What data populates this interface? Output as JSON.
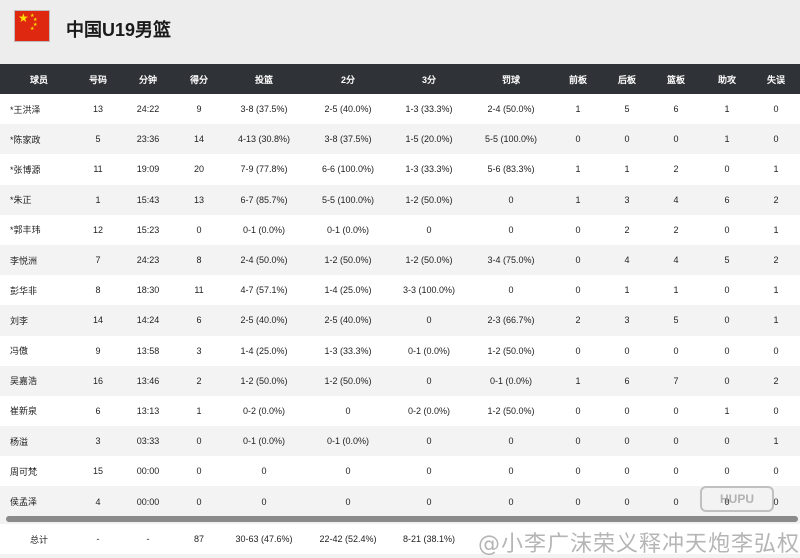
{
  "team": {
    "name": "中国U19男篮",
    "flag_icon": "china-flag-icon"
  },
  "columns": [
    "球员",
    "号码",
    "分钟",
    "得分",
    "投篮",
    "2分",
    "3分",
    "罚球",
    "前板",
    "后板",
    "篮板",
    "助攻",
    "失误"
  ],
  "rows": [
    [
      "*王洪泽",
      "13",
      "24:22",
      "9",
      "3-8 (37.5%)",
      "2-5 (40.0%)",
      "1-3 (33.3%)",
      "2-4 (50.0%)",
      "1",
      "5",
      "6",
      "1",
      "0"
    ],
    [
      "*陈家政",
      "5",
      "23:36",
      "14",
      "4-13 (30.8%)",
      "3-8 (37.5%)",
      "1-5 (20.0%)",
      "5-5 (100.0%)",
      "0",
      "0",
      "0",
      "1",
      "0"
    ],
    [
      "*张博源",
      "11",
      "19:09",
      "20",
      "7-9 (77.8%)",
      "6-6 (100.0%)",
      "1-3 (33.3%)",
      "5-6 (83.3%)",
      "1",
      "1",
      "2",
      "0",
      "1"
    ],
    [
      "*朱正",
      "1",
      "15:43",
      "13",
      "6-7 (85.7%)",
      "5-5 (100.0%)",
      "1-2 (50.0%)",
      "0",
      "1",
      "3",
      "4",
      "6",
      "2"
    ],
    [
      "*郭丰玮",
      "12",
      "15:23",
      "0",
      "0-1 (0.0%)",
      "0-1 (0.0%)",
      "0",
      "0",
      "0",
      "2",
      "2",
      "0",
      "1"
    ],
    [
      "李悦洲",
      "7",
      "24:23",
      "8",
      "2-4 (50.0%)",
      "1-2 (50.0%)",
      "1-2 (50.0%)",
      "3-4 (75.0%)",
      "0",
      "4",
      "4",
      "5",
      "2"
    ],
    [
      "彭华非",
      "8",
      "18:30",
      "11",
      "4-7 (57.1%)",
      "1-4 (25.0%)",
      "3-3 (100.0%)",
      "0",
      "0",
      "1",
      "1",
      "0",
      "1"
    ],
    [
      "刘李",
      "14",
      "14:24",
      "6",
      "2-5 (40.0%)",
      "2-5 (40.0%)",
      "0",
      "2-3 (66.7%)",
      "2",
      "3",
      "5",
      "0",
      "1"
    ],
    [
      "冯傲",
      "9",
      "13:58",
      "3",
      "1-4 (25.0%)",
      "1-3 (33.3%)",
      "0-1 (0.0%)",
      "1-2 (50.0%)",
      "0",
      "0",
      "0",
      "0",
      "0"
    ],
    [
      "吴嘉浩",
      "16",
      "13:46",
      "2",
      "1-2 (50.0%)",
      "1-2 (50.0%)",
      "0",
      "0-1 (0.0%)",
      "1",
      "6",
      "7",
      "0",
      "2"
    ],
    [
      "崔新泉",
      "6",
      "13:13",
      "1",
      "0-2 (0.0%)",
      "0",
      "0-2 (0.0%)",
      "1-2 (50.0%)",
      "0",
      "0",
      "0",
      "1",
      "0"
    ],
    [
      "杨溢",
      "3",
      "03:33",
      "0",
      "0-1 (0.0%)",
      "0-1 (0.0%)",
      "0",
      "0",
      "0",
      "0",
      "0",
      "0",
      "1"
    ],
    [
      "周可梵",
      "15",
      "00:00",
      "0",
      "0",
      "0",
      "0",
      "0",
      "0",
      "0",
      "0",
      "0",
      "0"
    ],
    [
      "侯孟泽",
      "4",
      "00:00",
      "0",
      "0",
      "0",
      "0",
      "0",
      "0",
      "0",
      "0",
      "0",
      "0"
    ]
  ],
  "totals": [
    "总计",
    "-",
    "-",
    "87",
    "30-63 (47.6%)",
    "22-42 (52.4%)",
    "8-21 (38.1%)",
    "",
    "",
    "",
    "",
    "",
    ""
  ],
  "watermark": "@小李广沫荣义释冲天炮李弘权",
  "logo": "HUPU"
}
